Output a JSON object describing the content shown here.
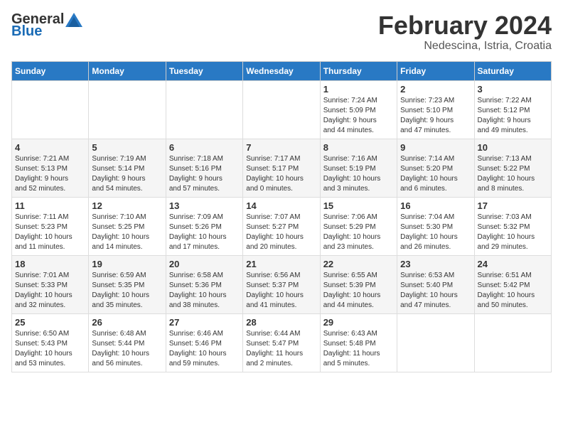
{
  "header": {
    "logo_general": "General",
    "logo_blue": "Blue",
    "month_year": "February 2024",
    "location": "Nedescina, Istria, Croatia"
  },
  "weekdays": [
    "Sunday",
    "Monday",
    "Tuesday",
    "Wednesday",
    "Thursday",
    "Friday",
    "Saturday"
  ],
  "weeks": [
    [
      {
        "day": "",
        "info": ""
      },
      {
        "day": "",
        "info": ""
      },
      {
        "day": "",
        "info": ""
      },
      {
        "day": "",
        "info": ""
      },
      {
        "day": "1",
        "info": "Sunrise: 7:24 AM\nSunset: 5:09 PM\nDaylight: 9 hours\nand 44 minutes."
      },
      {
        "day": "2",
        "info": "Sunrise: 7:23 AM\nSunset: 5:10 PM\nDaylight: 9 hours\nand 47 minutes."
      },
      {
        "day": "3",
        "info": "Sunrise: 7:22 AM\nSunset: 5:12 PM\nDaylight: 9 hours\nand 49 minutes."
      }
    ],
    [
      {
        "day": "4",
        "info": "Sunrise: 7:21 AM\nSunset: 5:13 PM\nDaylight: 9 hours\nand 52 minutes."
      },
      {
        "day": "5",
        "info": "Sunrise: 7:19 AM\nSunset: 5:14 PM\nDaylight: 9 hours\nand 54 minutes."
      },
      {
        "day": "6",
        "info": "Sunrise: 7:18 AM\nSunset: 5:16 PM\nDaylight: 9 hours\nand 57 minutes."
      },
      {
        "day": "7",
        "info": "Sunrise: 7:17 AM\nSunset: 5:17 PM\nDaylight: 10 hours\nand 0 minutes."
      },
      {
        "day": "8",
        "info": "Sunrise: 7:16 AM\nSunset: 5:19 PM\nDaylight: 10 hours\nand 3 minutes."
      },
      {
        "day": "9",
        "info": "Sunrise: 7:14 AM\nSunset: 5:20 PM\nDaylight: 10 hours\nand 6 minutes."
      },
      {
        "day": "10",
        "info": "Sunrise: 7:13 AM\nSunset: 5:22 PM\nDaylight: 10 hours\nand 8 minutes."
      }
    ],
    [
      {
        "day": "11",
        "info": "Sunrise: 7:11 AM\nSunset: 5:23 PM\nDaylight: 10 hours\nand 11 minutes."
      },
      {
        "day": "12",
        "info": "Sunrise: 7:10 AM\nSunset: 5:25 PM\nDaylight: 10 hours\nand 14 minutes."
      },
      {
        "day": "13",
        "info": "Sunrise: 7:09 AM\nSunset: 5:26 PM\nDaylight: 10 hours\nand 17 minutes."
      },
      {
        "day": "14",
        "info": "Sunrise: 7:07 AM\nSunset: 5:27 PM\nDaylight: 10 hours\nand 20 minutes."
      },
      {
        "day": "15",
        "info": "Sunrise: 7:06 AM\nSunset: 5:29 PM\nDaylight: 10 hours\nand 23 minutes."
      },
      {
        "day": "16",
        "info": "Sunrise: 7:04 AM\nSunset: 5:30 PM\nDaylight: 10 hours\nand 26 minutes."
      },
      {
        "day": "17",
        "info": "Sunrise: 7:03 AM\nSunset: 5:32 PM\nDaylight: 10 hours\nand 29 minutes."
      }
    ],
    [
      {
        "day": "18",
        "info": "Sunrise: 7:01 AM\nSunset: 5:33 PM\nDaylight: 10 hours\nand 32 minutes."
      },
      {
        "day": "19",
        "info": "Sunrise: 6:59 AM\nSunset: 5:35 PM\nDaylight: 10 hours\nand 35 minutes."
      },
      {
        "day": "20",
        "info": "Sunrise: 6:58 AM\nSunset: 5:36 PM\nDaylight: 10 hours\nand 38 minutes."
      },
      {
        "day": "21",
        "info": "Sunrise: 6:56 AM\nSunset: 5:37 PM\nDaylight: 10 hours\nand 41 minutes."
      },
      {
        "day": "22",
        "info": "Sunrise: 6:55 AM\nSunset: 5:39 PM\nDaylight: 10 hours\nand 44 minutes."
      },
      {
        "day": "23",
        "info": "Sunrise: 6:53 AM\nSunset: 5:40 PM\nDaylight: 10 hours\nand 47 minutes."
      },
      {
        "day": "24",
        "info": "Sunrise: 6:51 AM\nSunset: 5:42 PM\nDaylight: 10 hours\nand 50 minutes."
      }
    ],
    [
      {
        "day": "25",
        "info": "Sunrise: 6:50 AM\nSunset: 5:43 PM\nDaylight: 10 hours\nand 53 minutes."
      },
      {
        "day": "26",
        "info": "Sunrise: 6:48 AM\nSunset: 5:44 PM\nDaylight: 10 hours\nand 56 minutes."
      },
      {
        "day": "27",
        "info": "Sunrise: 6:46 AM\nSunset: 5:46 PM\nDaylight: 10 hours\nand 59 minutes."
      },
      {
        "day": "28",
        "info": "Sunrise: 6:44 AM\nSunset: 5:47 PM\nDaylight: 11 hours\nand 2 minutes."
      },
      {
        "day": "29",
        "info": "Sunrise: 6:43 AM\nSunset: 5:48 PM\nDaylight: 11 hours\nand 5 minutes."
      },
      {
        "day": "",
        "info": ""
      },
      {
        "day": "",
        "info": ""
      }
    ]
  ]
}
